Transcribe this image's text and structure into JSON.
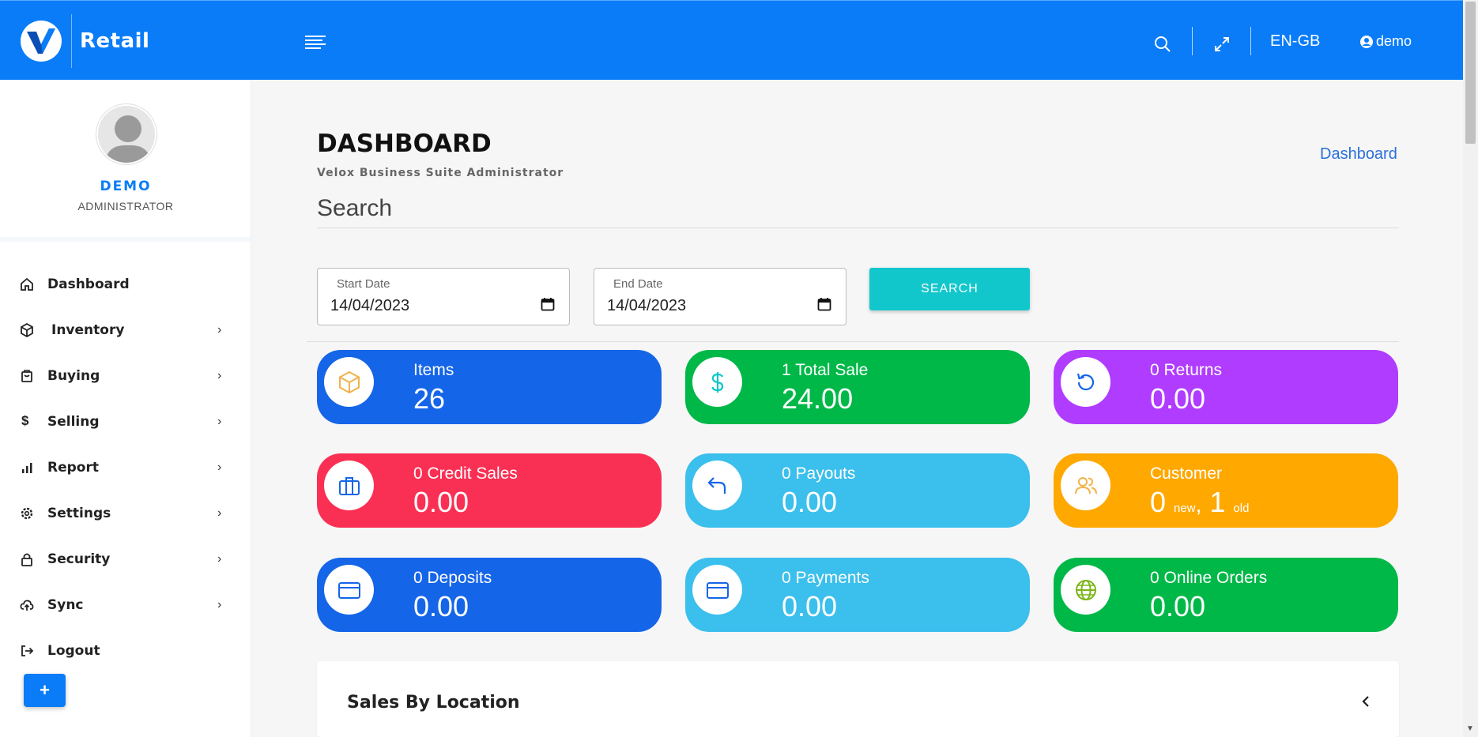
{
  "header": {
    "brand": "Retail",
    "language": "EN-GB",
    "user": "demo"
  },
  "profile": {
    "name": "DEMO",
    "role": "ADMINISTRATOR"
  },
  "sidebar": {
    "items": [
      {
        "label": "Dashboard",
        "icon": "home-icon"
      },
      {
        "label": "Inventory",
        "icon": "box-icon"
      },
      {
        "label": "Buying",
        "icon": "bag-icon"
      },
      {
        "label": "Selling",
        "icon": "dollar-icon"
      },
      {
        "label": "Report",
        "icon": "bar-chart-icon"
      },
      {
        "label": "Settings",
        "icon": "gear-icon"
      },
      {
        "label": "Security",
        "icon": "lock-icon"
      },
      {
        "label": "Sync",
        "icon": "cloud-upload-icon"
      },
      {
        "label": "Logout",
        "icon": "logout-icon"
      }
    ],
    "fab_label": "+"
  },
  "page": {
    "title": "DASHBOARD",
    "subtitle": "Velox Business Suite Administrator",
    "breadcrumb": "Dashboard",
    "search_heading": "Search"
  },
  "filters": {
    "start_label": "Start Date",
    "start_value": "14/04/2023",
    "end_label": "End Date",
    "end_value": "14/04/2023",
    "search_button": "SEARCH"
  },
  "cards": [
    {
      "title": "Items",
      "value": "26",
      "color": "#1565e8",
      "icon": "box-icon"
    },
    {
      "title": "1 Total Sale",
      "value": "24.00",
      "color": "#00b848",
      "icon": "dollar-icon"
    },
    {
      "title": "0 Returns",
      "value": "0.00",
      "color": "#b03cff",
      "icon": "refresh-icon"
    },
    {
      "title": "0 Credit Sales",
      "value": "0.00",
      "color": "#f93054",
      "icon": "briefcase-icon"
    },
    {
      "title": "0 Payouts",
      "value": "0.00",
      "color": "#3bbfec",
      "icon": "reply-icon"
    },
    {
      "title": "Customer",
      "value_new": "0",
      "new_label": "new",
      "comma": ",",
      "value_old": "1",
      "old_label": "old",
      "color": "#ffa800",
      "icon": "users-icon"
    },
    {
      "title": "0 Deposits",
      "value": "0.00",
      "color": "#1565e8",
      "icon": "credit-card-icon"
    },
    {
      "title": "0 Payments",
      "value": "0.00",
      "color": "#3bbfec",
      "icon": "credit-card-icon"
    },
    {
      "title": "0 Online Orders",
      "value": "0.00",
      "color": "#00b848",
      "icon": "globe-icon"
    }
  ],
  "panel": {
    "title": "Sales By Location"
  }
}
